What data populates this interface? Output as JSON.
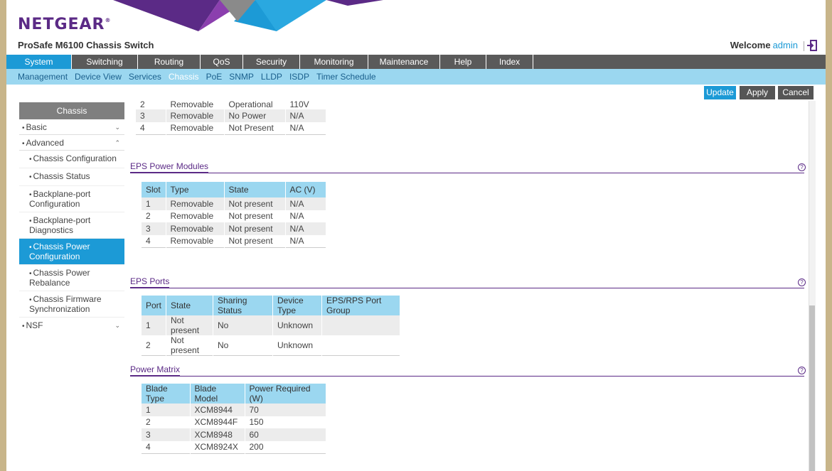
{
  "brand": {
    "logo": "NETGEAR",
    "logo_mark": "®",
    "product_title": "ProSafe M6100 Chassis Switch"
  },
  "user": {
    "welcome": "Welcome",
    "name": "admin"
  },
  "colors": {
    "accent": "#1c9ad6",
    "brand": "#5b2a86",
    "nav_bg": "#5a5a5a",
    "subnav_bg": "#9bd7f0"
  },
  "main_nav": [
    "System",
    "Switching",
    "Routing",
    "QoS",
    "Security",
    "Monitoring",
    "Maintenance",
    "Help",
    "Index"
  ],
  "sub_nav": [
    "Management",
    "Device View",
    "Services",
    "Chassis",
    "PoE",
    "SNMP",
    "LLDP",
    "ISDP",
    "Timer Schedule"
  ],
  "buttons": {
    "update": "Update",
    "apply": "Apply",
    "cancel": "Cancel"
  },
  "sidebar": {
    "title": "Chassis",
    "basic": "Basic",
    "advanced": "Advanced",
    "items": [
      "Chassis Configuration",
      "Chassis Status",
      "Backplane-port Configuration",
      "Backplane-port Diagnostics",
      "Chassis Power Configuration",
      "Chassis Power Rebalance",
      "Chassis Firmware Synchronization"
    ],
    "nsf": "NSF"
  },
  "power_supplies_partial": {
    "rows": [
      [
        "2",
        "Removable",
        "Operational",
        "110V"
      ],
      [
        "3",
        "Removable",
        "No Power",
        "N/A"
      ],
      [
        "4",
        "Removable",
        "Not Present",
        "N/A"
      ]
    ]
  },
  "eps_modules": {
    "title": "EPS Power Modules",
    "headers": [
      "Slot",
      "Type",
      "State",
      "AC (V)"
    ],
    "rows": [
      [
        "1",
        "Removable",
        "Not present",
        "N/A"
      ],
      [
        "2",
        "Removable",
        "Not present",
        "N/A"
      ],
      [
        "3",
        "Removable",
        "Not present",
        "N/A"
      ],
      [
        "4",
        "Removable",
        "Not present",
        "N/A"
      ]
    ]
  },
  "eps_ports": {
    "title": "EPS Ports",
    "headers": [
      "Port",
      "State",
      "Sharing Status",
      "Device Type",
      "EPS/RPS Port Group"
    ],
    "rows": [
      [
        "1",
        "Not present",
        "No",
        "Unknown",
        ""
      ],
      [
        "2",
        "Not present",
        "No",
        "Unknown",
        ""
      ]
    ]
  },
  "power_matrix": {
    "title": "Power Matrix",
    "headers": [
      "Blade Type",
      "Blade Model",
      "Power Required (W)"
    ],
    "rows": [
      [
        "1",
        "XCM8944",
        "70"
      ],
      [
        "2",
        "XCM8944F",
        "150"
      ],
      [
        "3",
        "XCM8948",
        "60"
      ],
      [
        "4",
        "XCM8924X",
        "200"
      ]
    ]
  },
  "icons": {
    "help": "help-icon",
    "logout": "logout-icon",
    "expand": "chevron-down-icon",
    "collapse": "chevron-up-icon"
  }
}
